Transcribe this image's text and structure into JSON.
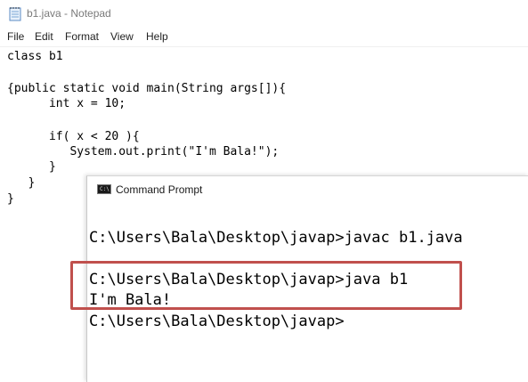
{
  "notepad": {
    "title": "b1.java - Notepad",
    "menu": [
      "File",
      "Edit",
      "Format",
      "View",
      "Help"
    ],
    "code_lines": [
      "class b1",
      "",
      "{public static void main(String args[]){",
      "      int x = 10;",
      "",
      "      if( x < 20 ){",
      "         System.out.print(\"I'm Bala!\");",
      "      }",
      "   }",
      "}"
    ]
  },
  "cmd": {
    "title": "Command Prompt",
    "icon_text": "C:\\",
    "lines": [
      "C:\\Users\\Bala\\Desktop\\javap>javac b1.java",
      "C:\\Users\\Bala\\Desktop\\javap>java b1",
      "I'm Bala!",
      "C:\\Users\\Bala\\Desktop\\javap>"
    ]
  },
  "colors": {
    "highlight": "#c0504d",
    "title_text": "#7a7a7a"
  }
}
